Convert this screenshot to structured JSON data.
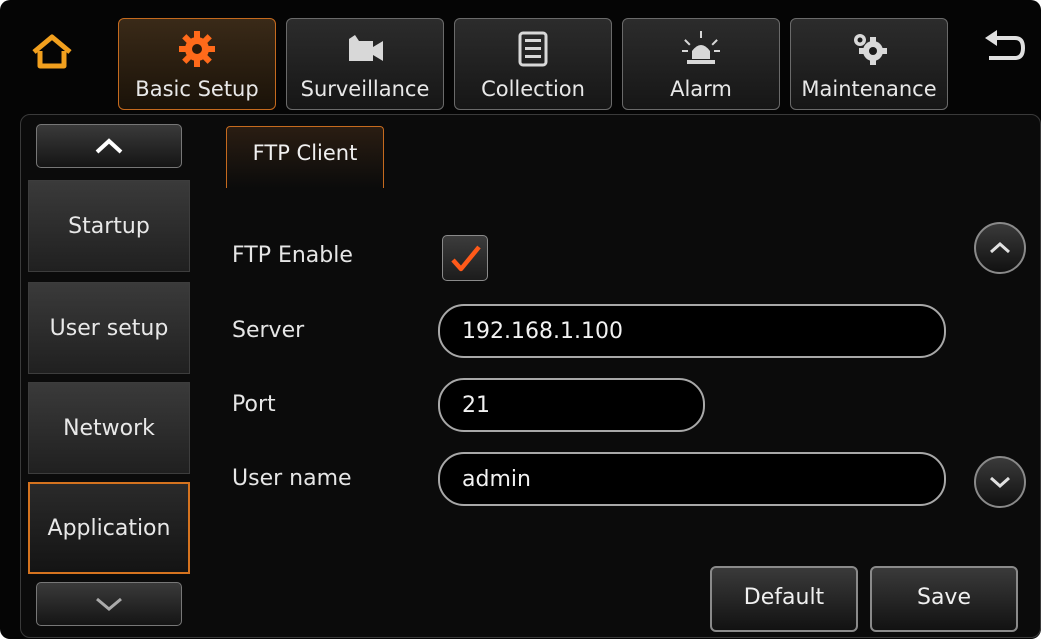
{
  "nav": {
    "tabs": [
      {
        "label": "Basic Setup",
        "icon": "gear-icon",
        "active": true
      },
      {
        "label": "Surveillance",
        "icon": "camera-icon",
        "active": false
      },
      {
        "label": "Collection",
        "icon": "document-icon",
        "active": false
      },
      {
        "label": "Alarm",
        "icon": "alarm-light-icon",
        "active": false
      },
      {
        "label": "Maintenance",
        "icon": "gears-icon",
        "active": false
      }
    ]
  },
  "sidebar": {
    "items": [
      {
        "label": "Startup"
      },
      {
        "label": "User setup"
      },
      {
        "label": "Network"
      },
      {
        "label": "Application",
        "active": true
      }
    ]
  },
  "section": {
    "title": "FTP Client"
  },
  "form": {
    "ftp_enable_label": "FTP Enable",
    "ftp_enable_checked": true,
    "server_label": "Server",
    "server_value": "192.168.1.100",
    "port_label": "Port",
    "port_value": "21",
    "username_label": "User name",
    "username_value": "admin"
  },
  "actions": {
    "default_label": "Default",
    "save_label": "Save"
  },
  "colors": {
    "accent": "#d5731f",
    "background": "#050505",
    "text": "#e8e8e8"
  }
}
